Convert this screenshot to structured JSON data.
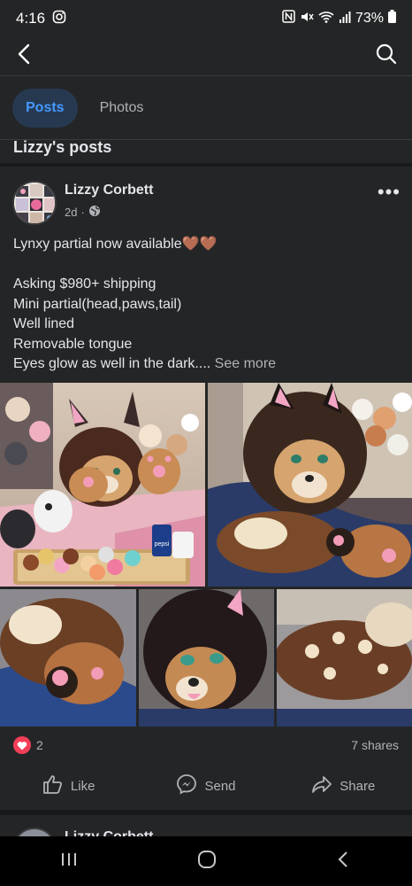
{
  "status_bar": {
    "time": "4:16",
    "battery": "73%"
  },
  "tabs": [
    {
      "label": "Posts",
      "active": true
    },
    {
      "label": "Photos",
      "active": false
    }
  ],
  "section_title": "Lizzy's posts",
  "post": {
    "author": "Lizzy Corbett",
    "time": "2d",
    "privacy_icon": "globe-icon",
    "lines": [
      "Lynxy partial now available🤎🤎",
      "",
      "Asking $980+ shipping",
      "Mini partial(head,paws,tail)",
      "Well lined",
      "Removable tongue"
    ],
    "last_line": "Eyes glow as well in the dark....",
    "see_more": "See more",
    "photos": [
      {
        "caption_label": "pepsi"
      }
    ],
    "reaction_count": "2",
    "shares": "7 shares",
    "actions": {
      "like": "Like",
      "send": "Send",
      "share": "Share"
    }
  },
  "next_post": {
    "author": "Lizzy Corbett"
  },
  "colors": {
    "accent": "#4599ff",
    "background": "#242526",
    "heart": "#f33e58"
  }
}
